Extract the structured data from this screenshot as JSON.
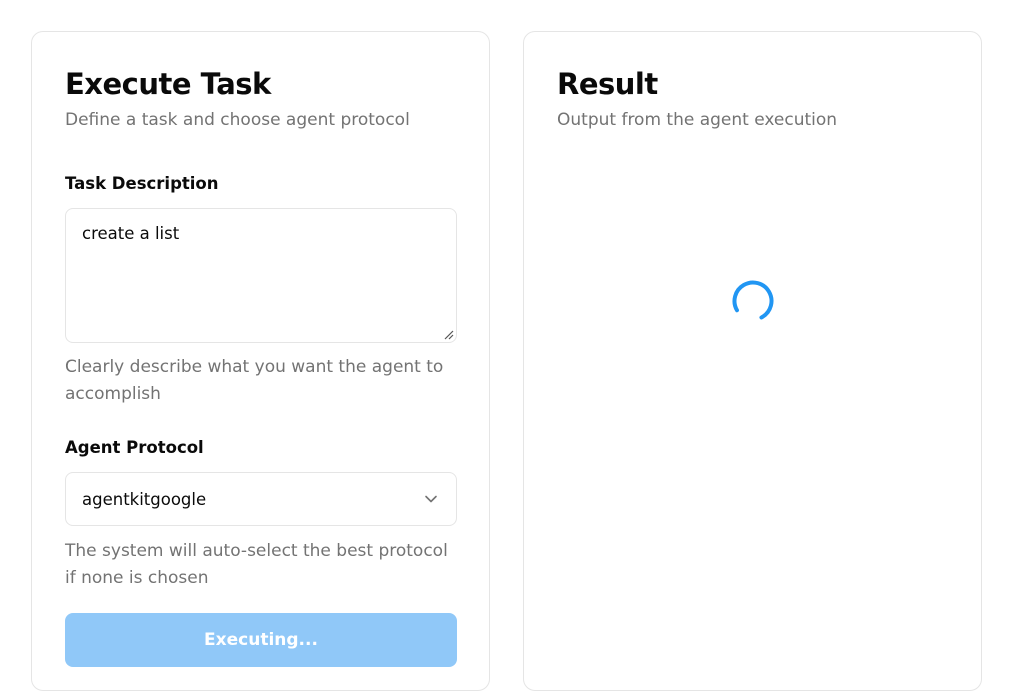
{
  "execute_panel": {
    "title": "Execute Task",
    "subtitle": "Define a task and choose agent protocol",
    "task_label": "Task Description",
    "task_value": "create a list",
    "task_help": "Clearly describe what you want the agent to accomplish",
    "protocol_label": "Agent Protocol",
    "protocol_value": "agentkitgoogle",
    "protocol_help": "The system will auto-select the best protocol if none is chosen",
    "button_label": "Executing...",
    "button_color": "#90c8f8"
  },
  "result_panel": {
    "title": "Result",
    "subtitle": "Output from the agent execution",
    "loading_icon": "spinner-icon",
    "spinner_color": "#2196f3"
  }
}
